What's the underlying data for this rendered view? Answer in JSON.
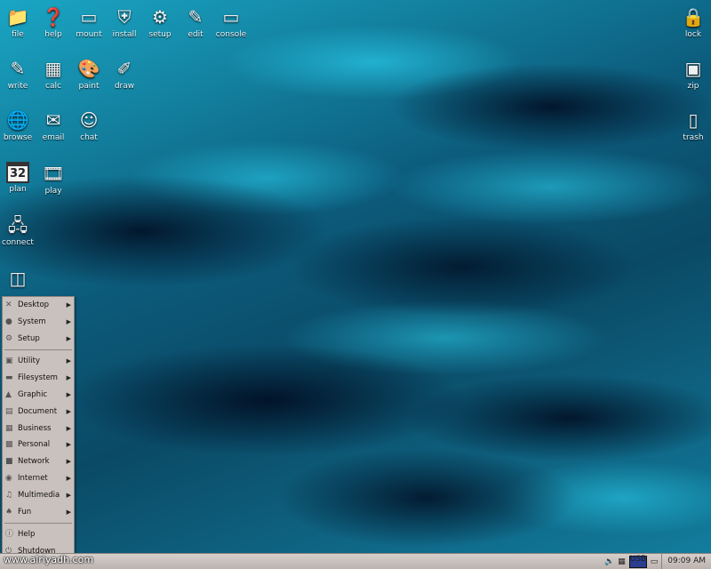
{
  "desktop_icons": {
    "file": {
      "label": "file",
      "icon": "folder-icon"
    },
    "help": {
      "label": "help",
      "icon": "help-icon"
    },
    "mount": {
      "label": "mount",
      "icon": "drive-icon"
    },
    "install": {
      "label": "install",
      "icon": "shield-icon"
    },
    "setup": {
      "label": "setup",
      "icon": "gear-icon"
    },
    "edit": {
      "label": "edit",
      "icon": "edit-icon"
    },
    "console": {
      "label": "console",
      "icon": "monitor-icon"
    },
    "lock": {
      "label": "lock",
      "icon": "lock-icon"
    },
    "zip": {
      "label": "zip",
      "icon": "zip-icon"
    },
    "trash": {
      "label": "trash",
      "icon": "trash-icon"
    },
    "write": {
      "label": "write",
      "icon": "write-icon"
    },
    "calc": {
      "label": "calc",
      "icon": "calculator-icon"
    },
    "paint": {
      "label": "paint",
      "icon": "palette-icon"
    },
    "draw": {
      "label": "draw",
      "icon": "draw-icon"
    },
    "browse": {
      "label": "browse",
      "icon": "globe-icon"
    },
    "email": {
      "label": "email",
      "icon": "mail-icon"
    },
    "chat": {
      "label": "chat",
      "icon": "chat-icon"
    },
    "plan": {
      "label": "plan",
      "icon": "calendar-icon",
      "badge": "32"
    },
    "play": {
      "label": "play",
      "icon": "media-icon"
    },
    "connect": {
      "label": "connect",
      "icon": "network-icon"
    },
    "menu": {
      "icon": "menu-icon"
    }
  },
  "menu": {
    "items": [
      {
        "label": "Desktop",
        "icon": "desktop-icon",
        "submenu": true
      },
      {
        "label": "System",
        "icon": "system-icon",
        "submenu": true
      },
      {
        "label": "Setup",
        "icon": "gear-icon",
        "submenu": true
      },
      {
        "label": "Utility",
        "icon": "utility-icon",
        "submenu": true
      },
      {
        "label": "Filesystem",
        "icon": "folder-icon",
        "submenu": true
      },
      {
        "label": "Graphic",
        "icon": "graphic-icon",
        "submenu": true
      },
      {
        "label": "Document",
        "icon": "document-icon",
        "submenu": true
      },
      {
        "label": "Business",
        "icon": "business-icon",
        "submenu": true
      },
      {
        "label": "Personal",
        "icon": "personal-icon",
        "submenu": true
      },
      {
        "label": "Network",
        "icon": "network-icon",
        "submenu": true
      },
      {
        "label": "Internet",
        "icon": "internet-icon",
        "submenu": true
      },
      {
        "label": "Multimedia",
        "icon": "multimedia-icon",
        "submenu": true
      },
      {
        "label": "Fun",
        "icon": "fun-icon",
        "submenu": true
      }
    ],
    "help": "Help",
    "shutdown": "Shutdown"
  },
  "taskbar": {
    "watermark": "www.alriyadh.com",
    "usb_label": "USB",
    "clock": "09:09 AM"
  },
  "colors": {
    "accent": "#1aa6c4",
    "menu_bg": "#c9c1bd",
    "taskbar_bg": "#c8c0bc"
  }
}
